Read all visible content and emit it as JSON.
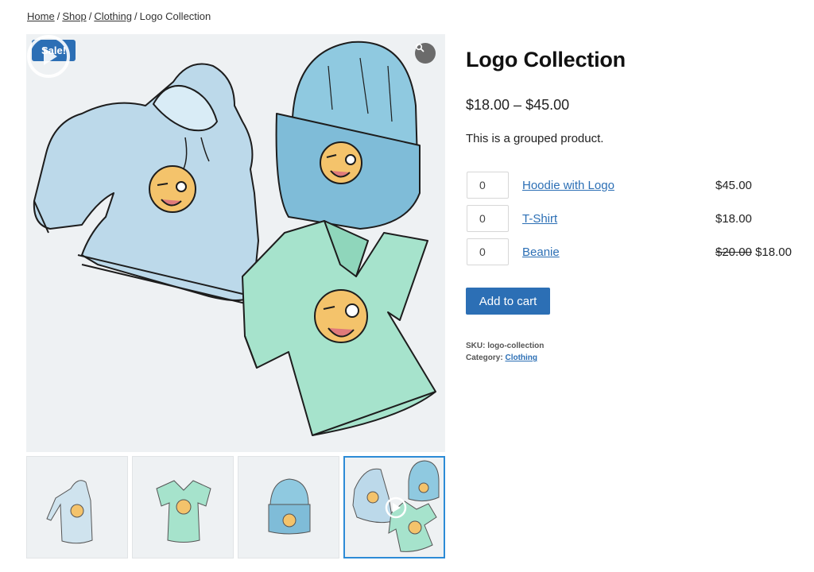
{
  "breadcrumb": {
    "items": [
      "Home",
      "Shop",
      "Clothing"
    ],
    "current": "Logo Collection",
    "separator": "/"
  },
  "gallery": {
    "sale_badge": "Sale!",
    "zoom_icon": "search-icon",
    "play_icon": "play-icon",
    "thumbnails": [
      "hoodie",
      "t-shirt",
      "beanie",
      "logo-collection"
    ],
    "active_thumbnail": 3
  },
  "product": {
    "title": "Logo Collection",
    "price_range": "$18.00 – $45.00",
    "description": "This is a grouped product.",
    "items": [
      {
        "qty": "0",
        "name": "Hoodie with Logo",
        "price": "$45.00",
        "old_price": ""
      },
      {
        "qty": "0",
        "name": "T-Shirt",
        "price": "$18.00",
        "old_price": ""
      },
      {
        "qty": "0",
        "name": "Beanie",
        "price": "$18.00",
        "old_price": "$20.00"
      }
    ],
    "add_to_cart": "Add to cart",
    "sku_label": "SKU:",
    "sku": "logo-collection",
    "category_label": "Category:",
    "category": "Clothing"
  },
  "colors": {
    "accent": "#2c6fb5",
    "hoodie": "#bcd9ea",
    "tshirt": "#a6e3cc",
    "beanie": "#8fc9e0",
    "emoji": "#f4c36b"
  }
}
